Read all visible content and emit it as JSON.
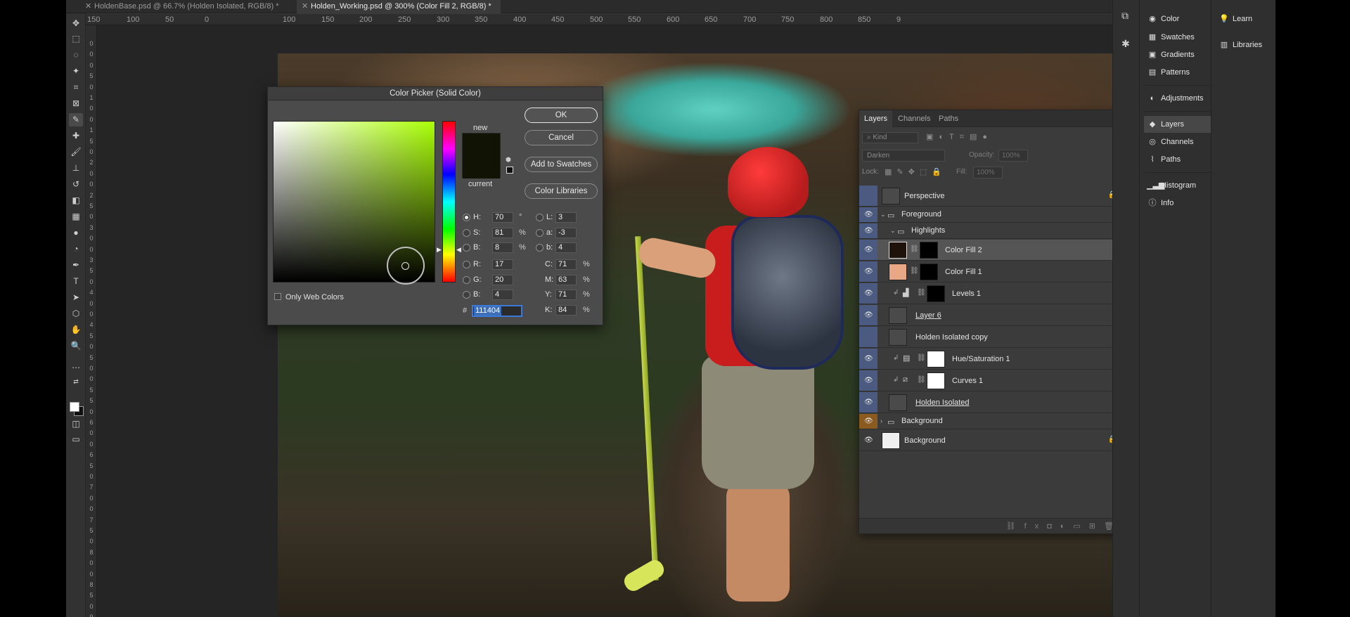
{
  "tabs": [
    {
      "label": "HoldenBase.psd @ 66.7% (Holden Isolated, RGB/8) *",
      "active": false
    },
    {
      "label": "Holden_Working.psd @ 300% (Color Fill 2, RGB/8) *",
      "active": true
    }
  ],
  "ruler": {
    "h_labels": [
      "150",
      "100",
      "50",
      "0",
      "100",
      "150",
      "200",
      "250",
      "300",
      "350",
      "400",
      "450",
      "500",
      "550",
      "600",
      "650",
      "700",
      "750",
      "800",
      "850",
      "9"
    ],
    "v_labels": [
      "0",
      "0",
      "0",
      "5",
      "0",
      "1",
      "0",
      "0",
      "1",
      "5",
      "0",
      "2",
      "0",
      "0",
      "2",
      "5",
      "0",
      "3",
      "0",
      "0",
      "3",
      "5",
      "0",
      "4",
      "0",
      "0",
      "4",
      "5",
      "0",
      "5",
      "0",
      "0",
      "5",
      "5",
      "0",
      "6",
      "0",
      "0",
      "6",
      "5",
      "0",
      "7",
      "0",
      "0",
      "7",
      "5",
      "0",
      "8",
      "0",
      "0",
      "8",
      "5",
      "0",
      "9"
    ]
  },
  "tools": [
    "move-tool",
    "marquee-tool",
    "lasso-tool",
    "magic-wand-tool",
    "crop-tool",
    "frame-tool",
    "eyedropper-tool",
    "healing-tool",
    "brush-tool",
    "stamp-tool",
    "history-brush-tool",
    "eraser-tool",
    "gradient-tool",
    "blur-tool",
    "dodge-tool",
    "pen-tool",
    "type-tool",
    "path-select-tool",
    "shape-tool",
    "hand-tool",
    "zoom-tool",
    "more-tools"
  ],
  "color_picker": {
    "title": "Color Picker (Solid Color)",
    "ok": "OK",
    "cancel": "Cancel",
    "add_to_swatches": "Add to Swatches",
    "color_libraries": "Color Libraries",
    "new_label": "new",
    "current_label": "current",
    "only_web_colors": "Only Web Colors",
    "new_color": "#111404",
    "current_color": "#111404",
    "fields": {
      "H": {
        "label": "H:",
        "value": "70",
        "unit": "°"
      },
      "S": {
        "label": "S:",
        "value": "81",
        "unit": "%"
      },
      "B": {
        "label": "B:",
        "value": "8",
        "unit": "%"
      },
      "R": {
        "label": "R:",
        "value": "17",
        "unit": ""
      },
      "G": {
        "label": "G:",
        "value": "20",
        "unit": ""
      },
      "Bl": {
        "label": "B:",
        "value": "4",
        "unit": ""
      },
      "L": {
        "label": "L:",
        "value": "3",
        "unit": ""
      },
      "a": {
        "label": "a:",
        "value": "-3",
        "unit": ""
      },
      "b": {
        "label": "b:",
        "value": "4",
        "unit": ""
      },
      "C": {
        "label": "C:",
        "value": "71",
        "unit": "%"
      },
      "M": {
        "label": "M:",
        "value": "63",
        "unit": "%"
      },
      "Y": {
        "label": "Y:",
        "value": "71",
        "unit": "%"
      },
      "K": {
        "label": "K:",
        "value": "84",
        "unit": "%"
      }
    },
    "hash": "#",
    "hex": "111404"
  },
  "layers_panel": {
    "tabs": [
      "Layers",
      "Channels",
      "Paths"
    ],
    "filter_placeholder": "Kind",
    "blend_mode": "Darken",
    "opacity_label": "Opacity:",
    "opacity_value": "100%",
    "lock_label": "Lock:",
    "fill_label": "Fill:",
    "fill_value": "100%",
    "layers": [
      {
        "name": "Perspective",
        "type": "layer",
        "locked": true
      },
      {
        "name": "Foreground",
        "type": "group"
      },
      {
        "name": "Highlights",
        "type": "group"
      },
      {
        "name": "Color Fill 2",
        "type": "fill",
        "selected": true
      },
      {
        "name": "Color Fill 1",
        "type": "fill"
      },
      {
        "name": "Levels 1",
        "type": "adjustment"
      },
      {
        "name": "Layer 6",
        "type": "layer"
      },
      {
        "name": "Holden Isolated copy",
        "type": "smart"
      },
      {
        "name": "Hue/Saturation 1",
        "type": "adjustment"
      },
      {
        "name": "Curves 1",
        "type": "adjustment"
      },
      {
        "name": "Holden Isolated",
        "type": "smart"
      },
      {
        "name": "Background",
        "type": "group"
      },
      {
        "name": "Background",
        "type": "layer",
        "locked": true
      }
    ]
  },
  "dock": {
    "col1": [
      {
        "label": "Color",
        "icon": "palette-icon"
      },
      {
        "label": "Swatches",
        "icon": "grid-icon"
      },
      {
        "label": "Gradients",
        "icon": "gradient-icon"
      },
      {
        "label": "Patterns",
        "icon": "pattern-icon"
      },
      {
        "label": "Adjustments",
        "icon": "adjustments-icon"
      },
      {
        "label": "Layers",
        "icon": "layers-icon"
      },
      {
        "label": "Channels",
        "icon": "channels-icon"
      },
      {
        "label": "Paths",
        "icon": "paths-icon"
      },
      {
        "label": "Histogram",
        "icon": "histogram-icon"
      },
      {
        "label": "Info",
        "icon": "info-icon"
      }
    ],
    "col2": [
      {
        "label": "Learn",
        "icon": "lightbulb-icon"
      },
      {
        "label": "Libraries",
        "icon": "libraries-icon"
      }
    ]
  }
}
